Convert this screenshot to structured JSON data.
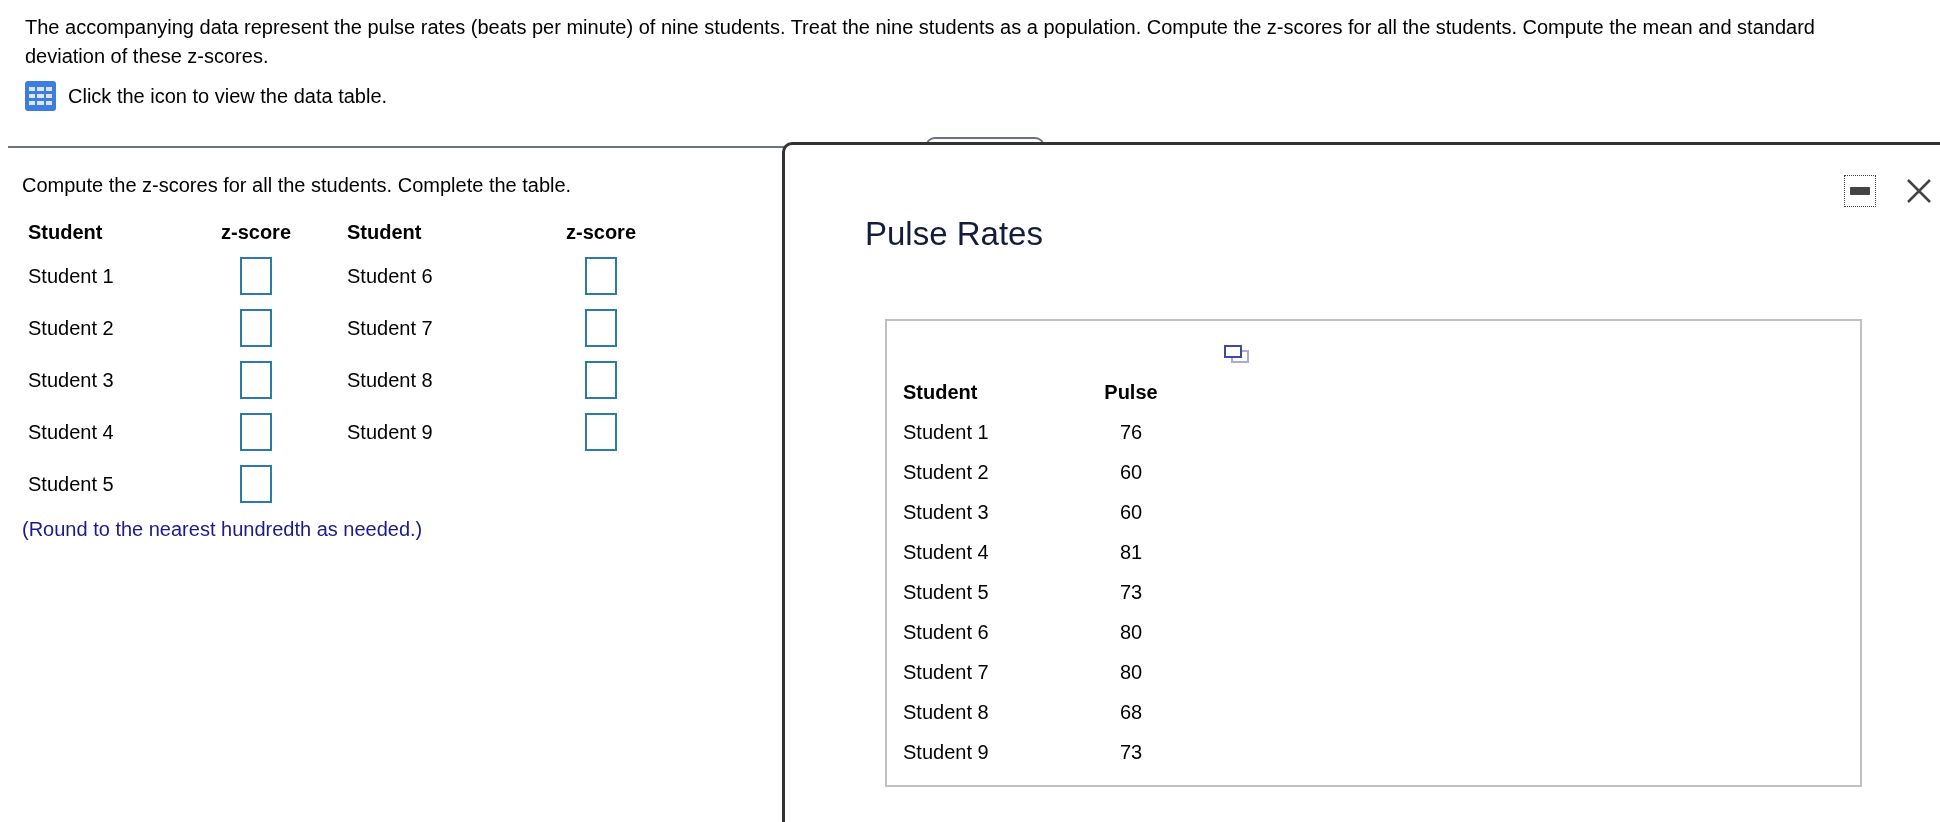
{
  "intro": {
    "text": "The accompanying data represent the pulse rates (beats per minute) of nine students. Treat the nine students as a population. Compute the z-scores for all the students. Compute the mean and standard deviation of these z-scores.",
    "link": "Click the icon to view the data table."
  },
  "answer": {
    "prompt": "Compute the z-scores for all the students. Complete the table.",
    "columns": [
      "Student",
      "z-score",
      "Student",
      "z-score"
    ],
    "groups": [
      {
        "students": [
          "Student 1",
          "Student 2",
          "Student 3",
          "Student 4",
          "Student 5"
        ]
      },
      {
        "students": [
          "Student 6",
          "Student 7",
          "Student 8",
          "Student 9"
        ]
      }
    ],
    "note": "(Round to the nearest hundredth as needed.)"
  },
  "dialog": {
    "title": "Pulse Rates",
    "table": {
      "columns": [
        "Student",
        "Pulse"
      ],
      "rows": [
        [
          "Student 1",
          "76"
        ],
        [
          "Student 2",
          "60"
        ],
        [
          "Student 3",
          "60"
        ],
        [
          "Student 4",
          "81"
        ],
        [
          "Student 5",
          "73"
        ],
        [
          "Student 6",
          "80"
        ],
        [
          "Student 7",
          "80"
        ],
        [
          "Student 8",
          "68"
        ],
        [
          "Student 9",
          "73"
        ]
      ]
    }
  }
}
